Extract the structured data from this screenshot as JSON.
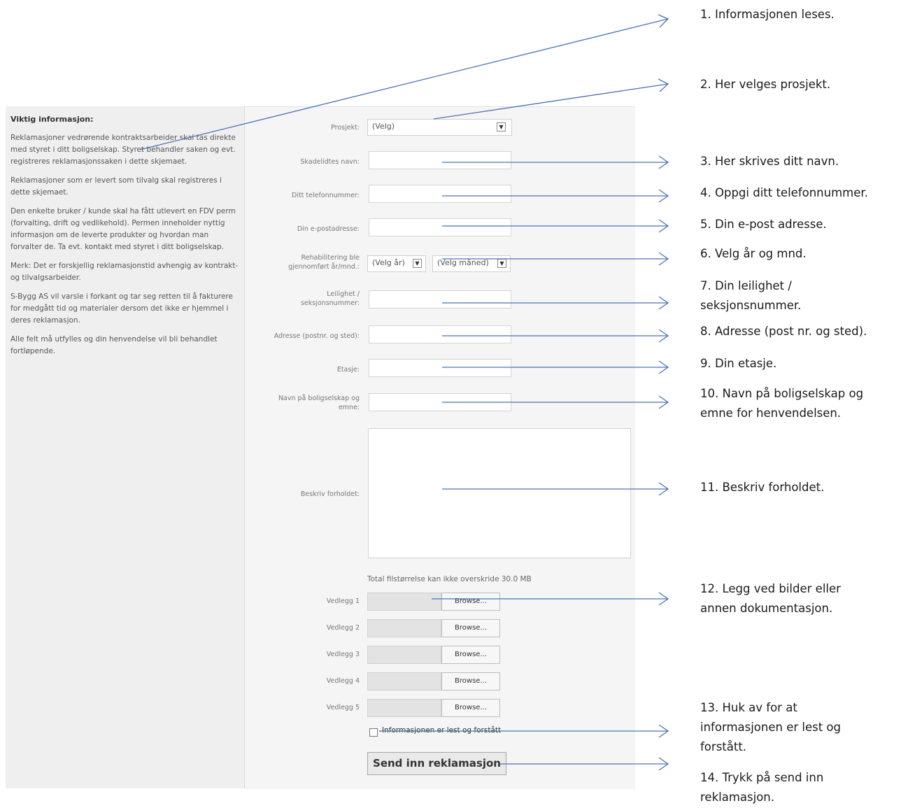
{
  "sidebar": {
    "heading": "Viktig informasjon:",
    "paragraphs": [
      "Reklamasjoner vedrørende kontraktsarbeider skal tas direkte med styret i ditt boligselskap. Styret behandler saken og evt. registreres reklamasjonssaken i dette skjemaet.",
      "Reklamasjoner som er levert som tilvalg skal registreres i dette skjemaet.",
      "Den enkelte bruker / kunde skal ha fått utlevert en FDV perm (forvalting, drift og vedlikehold). Permen inneholder nyttig informasjon om de leverte produkter og hvordan man forvalter de. Ta evt. kontakt med styret i ditt boligselskap.",
      "Merk: Det er forskjellig reklamasjonstid avhengig av kontrakt- og tilvalgsarbeider.",
      "S-Bygg AS vil varsle i forkant og tar seg retten til å fakturere for medgått tid og materialer dersom det ikke er hjemmel i deres reklamasjon.",
      "Alle felt må utfylles og din henvendelse vil bli behandlet fortløpende."
    ]
  },
  "form": {
    "project_label": "Prosjekt:",
    "project_value": "(Velg)",
    "name_label": "Skadelidtes navn:",
    "phone_label": "Ditt telefonnummer:",
    "email_label": "Din e-postadresse:",
    "rehab_label_1": "Rehabilitering ble",
    "rehab_label_2": "gjennomført år/mnd.:",
    "year_value": "(Velg år)",
    "month_value": "(Velg måned)",
    "apartment_label_1": "Leilighet /",
    "apartment_label_2": "seksjonsnummer:",
    "address_label": "Adresse (postnr. og sted):",
    "floor_label": "Etasje:",
    "association_label_1": "Navn på boligselskap og",
    "association_label_2": "emne:",
    "description_label": "Beskriv forholdet:",
    "file_size_note": "Total filstørrelse kan ikke overskride 30.0 MB",
    "attachments": [
      {
        "label": "Vedlegg 1",
        "button": "Browse..."
      },
      {
        "label": "Vedlegg 2",
        "button": "Browse..."
      },
      {
        "label": "Vedlegg 3",
        "button": "Browse..."
      },
      {
        "label": "Vedlegg 4",
        "button": "Browse..."
      },
      {
        "label": "Vedlegg 5",
        "button": "Browse..."
      }
    ],
    "checkbox_label": "Informasjonen er lest og forstått",
    "submit_label": "Send inn reklamasjon"
  },
  "annotations": {
    "a1": "1. Informasjonen leses.",
    "a2": "2. Her velges prosjekt.",
    "a3": "3. Her skrives ditt navn.",
    "a4": "4. Oppgi ditt telefonnummer.",
    "a5": "5. Din e-post adresse.",
    "a6": "6. Velg år og mnd.",
    "a7_1": "7. Din leilighet /",
    "a7_2": "seksjonsnummer.",
    "a8": "8. Adresse (post nr. og sted).",
    "a9": "9. Din etasje.",
    "a10_1": "10. Navn på boligselskap og",
    "a10_2": "emne for henvendelsen.",
    "a11": "11. Beskriv forholdet.",
    "a12_1": "12. Legg ved bilder eller",
    "a12_2": "annen dokumentasjon.",
    "a13_1": "13. Huk av for at",
    "a13_2": "informasjonen er lest og",
    "a13_3": "forstått.",
    "a14_1": "14. Trykk på send inn",
    "a14_2": "reklamasjon."
  },
  "colors": {
    "arrow": "#4a74b4"
  }
}
